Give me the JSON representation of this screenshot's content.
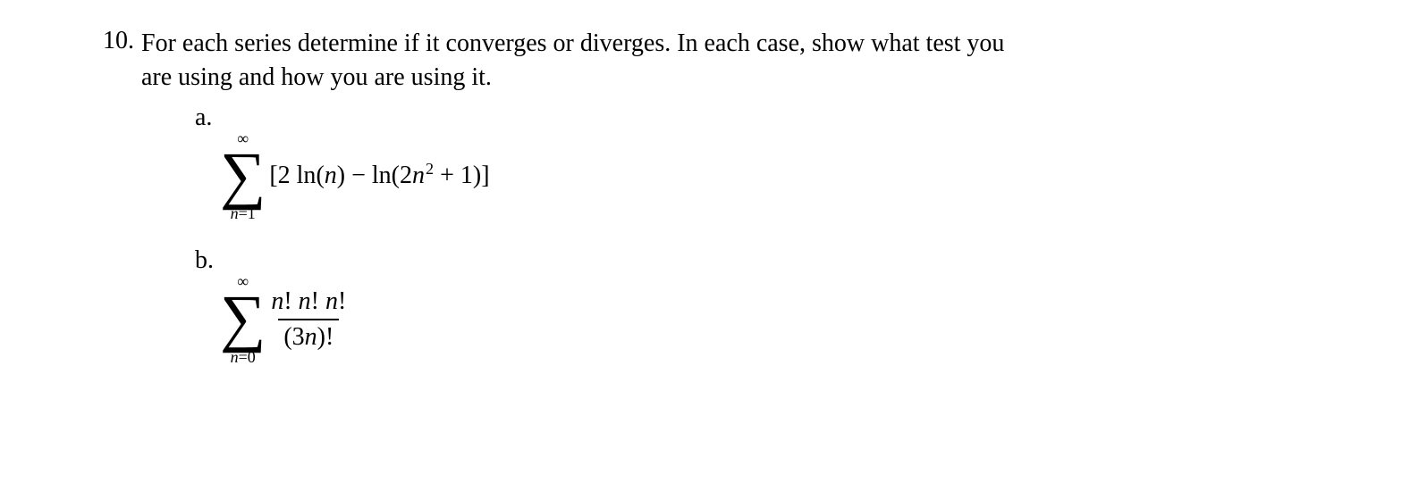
{
  "problem": {
    "number": "10.",
    "text_line1": "For each series determine if it converges or diverges.  In each case, show what test you",
    "text_line2": "are using and how you are using it.",
    "parts": {
      "a": {
        "label": "a.",
        "sum_upper": "∞",
        "sum_lower_var": "n",
        "sum_lower_eq": "=1",
        "expr_open": "[2",
        "expr_fn1": " ln",
        "expr_arg1_open": "(",
        "expr_arg1_var": "n",
        "expr_arg1_close": ")",
        "expr_op": " − ",
        "expr_fn2": "ln",
        "expr_arg2_open": "(2",
        "expr_arg2_var": "n",
        "expr_arg2_sup": "2",
        "expr_arg2_rest": " + 1)",
        "expr_close": "]"
      },
      "b": {
        "label": "b.",
        "sum_upper": "∞",
        "sum_lower_var": "n",
        "sum_lower_eq": "=0",
        "frac_top_n1": "n",
        "frac_top_bang1": "! ",
        "frac_top_n2": "n",
        "frac_top_bang2": "! ",
        "frac_top_n3": "n",
        "frac_top_bang3": "!",
        "frac_bot_open": "(3",
        "frac_bot_var": "n",
        "frac_bot_close": ")!"
      }
    }
  }
}
